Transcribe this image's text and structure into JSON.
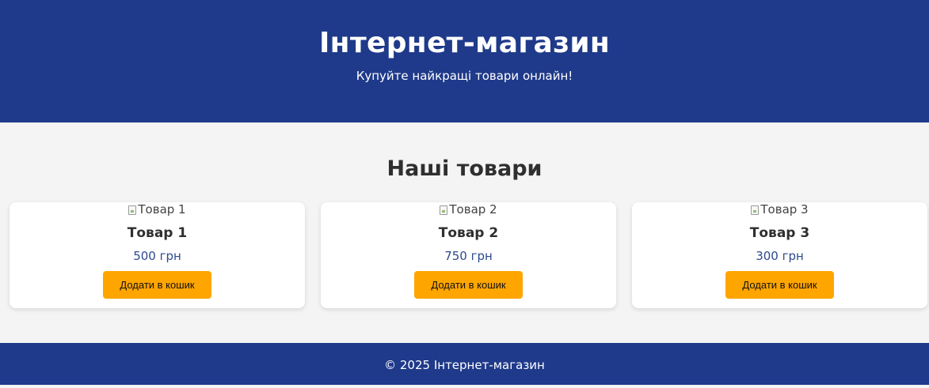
{
  "header": {
    "title": "Інтернет-магазин",
    "tagline": "Купуйте найкращі товари онлайн!"
  },
  "products_section": {
    "title": "Наші товари",
    "items": [
      {
        "image_alt": "Товар 1",
        "name": "Товар 1",
        "price": "500 грн",
        "button_label": "Додати в кошик"
      },
      {
        "image_alt": "Товар 2",
        "name": "Товар 2",
        "price": "750 грн",
        "button_label": "Додати в кошик"
      },
      {
        "image_alt": "Товар 3",
        "name": "Товар 3",
        "price": "300 грн",
        "button_label": "Додати в кошик"
      }
    ]
  },
  "footer": {
    "text": "© 2025 Інтернет-магазин"
  },
  "colors": {
    "primary": "#1f3a8a",
    "accent": "#ffa500",
    "price": "#2c4a8f",
    "background": "#f4f4f4"
  }
}
